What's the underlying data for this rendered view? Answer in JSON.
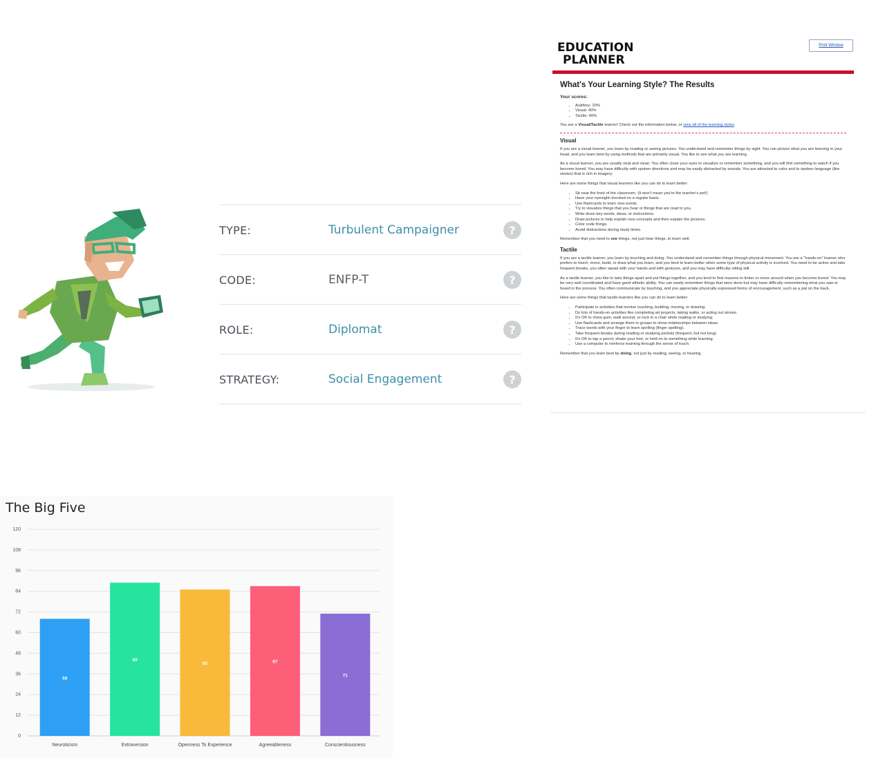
{
  "persona": {
    "traits": [
      {
        "label": "TYPE:",
        "value": "Turbulent Campaigner",
        "help": "?"
      },
      {
        "label": "CODE:",
        "value": "ENFP-T",
        "help": "?"
      },
      {
        "label": "ROLE:",
        "value": "Diplomat",
        "help": "?"
      },
      {
        "label": "STRATEGY:",
        "value": "Social Engagement",
        "help": "?"
      }
    ],
    "accent_color": "#3d8fa8"
  },
  "edu": {
    "logo_line1": "EDUCATION",
    "logo_line2": "PLANNER",
    "print_label": "Print Window",
    "title": "What's Your Learning Style? The Results",
    "scores_heading": "Your scores:",
    "scores": [
      "Auditory: 20%",
      "Visual: 40%",
      "Tactile: 40%"
    ],
    "summary_pre": "You are a ",
    "summary_type": "Visual/Tactile",
    "summary_mid": " learner! Check out the information below, or ",
    "summary_link": "view all of the learning styles",
    "summary_end": ".",
    "visual": {
      "heading": "Visual",
      "p1": "If you are a visual learner, you learn by reading or seeing pictures. You understand and remember things by sight. You can picture what you are learning in your head, and you learn best by using methods that are primarily visual. You like to see what you are learning.",
      "p2": "As a visual learner, you are usually neat and clean. You often close your eyes to visualize or remember something, and you will find something to watch if you become bored. You may have difficulty with spoken directions and may be easily distracted by sounds. You are attracted to color and to spoken language (like stories) that is rich in imagery.",
      "tips_intro": "Here are some things that visual learners like you can do to learn better:",
      "tips": [
        "Sit near the front of the classroom. (It won't mean you're the teacher's pet!)",
        "Have your eyesight checked on a regular basis.",
        "Use flashcards to learn new words.",
        "Try to visualize things that you hear or things that are read to you.",
        "Write down key words, ideas, or instructions.",
        "Draw pictures to help explain new concepts and then explain the pictures.",
        "Color code things.",
        "Avoid distractions during study times."
      ],
      "closing_pre": "Remember that you need to ",
      "closing_bold": "see",
      "closing_end": " things, not just hear things, to learn well."
    },
    "tactile": {
      "heading": "Tactile",
      "p1": "If you are a tactile learner, you learn by touching and doing. You understand and remember things through physical movement. You are a \"hands-on\" learner who prefers to touch, move, build, or draw what you learn, and you tend to learn better when some type of physical activity is involved. You need to be active and take frequent breaks, you often speak with your hands and with gestures, and you may have difficulty sitting still.",
      "p2": "As a tactile learner, you like to take things apart and put things together, and you tend to find reasons to tinker or move around when you become bored. You may be very well coordinated and have good athletic ability. You can easily remember things that were done but may have difficulty remembering what you saw or heard in the process. You often communicate by touching, and you appreciate physically expressed forms of encouragement, such as a pat on the back.",
      "tips_intro": "Here are some things that tactile learners like you can do to learn better:",
      "tips": [
        "Participate in activities that involve touching, building, moving, or drawing.",
        "Do lots of hands-on activities like completing art projects, taking walks, or acting out stories.",
        "It's OK to chew gum, walk around, or rock in a chair while reading or studying.",
        "Use flashcards and arrange them in groups to show relationships between ideas.",
        "Trace words with your finger to learn spelling (finger spelling).",
        "Take frequent breaks during reading or studying periods (frequent, but not long).",
        "It's OK to tap a pencil, shake your foot, or hold on to something while learning.",
        "Use a computer to reinforce learning through the sense of touch."
      ],
      "closing_pre": "Remember that you learn best by ",
      "closing_bold": "doing",
      "closing_end": ", not just by reading, seeing, or hearing."
    },
    "brand_color": "#c8102e"
  },
  "chart_data": {
    "type": "bar",
    "title": "The Big Five",
    "categories": [
      "Neuroticism",
      "Extraversion",
      "Openness To Experience",
      "Agreeableness",
      "Conscientiousness"
    ],
    "values": [
      68,
      89,
      85,
      87,
      71
    ],
    "colors": [
      "#2d9ff5",
      "#27e3a0",
      "#f9b93b",
      "#fd5e78",
      "#8b6dd6"
    ],
    "yticks": [
      0,
      12,
      24,
      36,
      48,
      60,
      72,
      84,
      96,
      108,
      120
    ],
    "ylim": [
      0,
      120
    ],
    "grid": true,
    "legend": "none"
  }
}
